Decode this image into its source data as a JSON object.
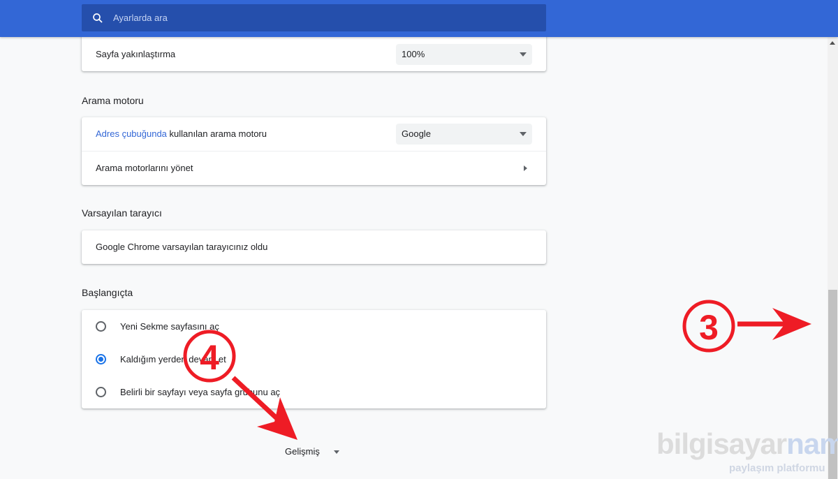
{
  "search": {
    "placeholder": "Ayarlarda ara"
  },
  "appearance": {
    "zoom_label": "Sayfa yakınlaştırma",
    "zoom_value": "100%"
  },
  "search_engine": {
    "title": "Arama motoru",
    "address_bar_link": "Adres çubuğunda",
    "address_bar_rest": " kullanılan arama motoru",
    "engine_value": "Google",
    "manage_label": "Arama motorlarını yönet"
  },
  "default_browser": {
    "title": "Varsayılan tarayıcı",
    "status": "Google Chrome varsayılan tarayıcınız oldu"
  },
  "startup": {
    "title": "Başlangıçta",
    "options": [
      {
        "label": "Yeni Sekme sayfasını aç",
        "checked": false
      },
      {
        "label": "Kaldığım yerden devam et",
        "checked": true
      },
      {
        "label": "Belirli bir sayfayı veya sayfa grubunu aç",
        "checked": false
      }
    ]
  },
  "advanced": {
    "label": "Gelişmiş"
  },
  "annotations": {
    "step3": "3",
    "step4": "4",
    "color": "#ee1c25"
  },
  "watermark": {
    "brand_a": "bilgisayar",
    "brand_b": "name",
    "tagline": "paylaşım platformu"
  },
  "colors": {
    "topbar": "#3367d6",
    "search_bg": "#254fac",
    "link": "#3367d6",
    "radio_checked": "#1a73e8"
  }
}
